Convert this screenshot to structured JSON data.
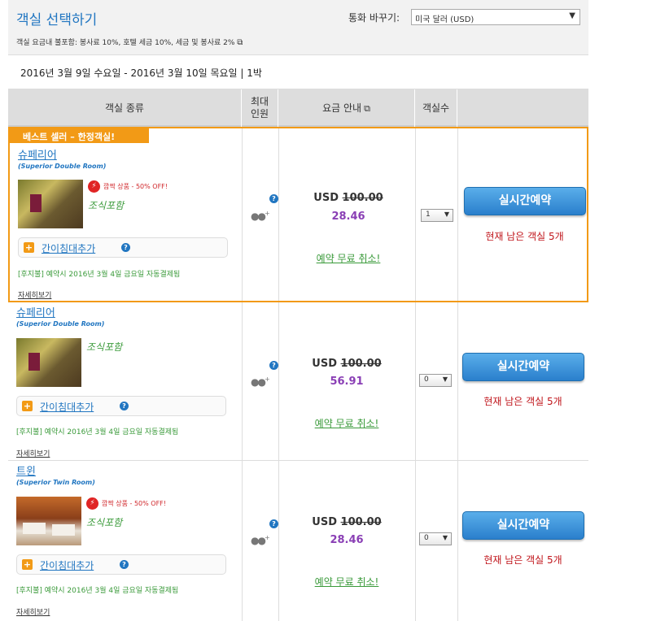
{
  "header": {
    "title": "객실 선택하기",
    "currency_label": "통화 바꾸기:",
    "currency_value": "미국 달러 (USD)",
    "tax_note": "객실 요금내 불포함: 봉사료 10%, 호텔 세금 10%, 세금 및 봉사료 2%"
  },
  "date_range": "2016년 3월 9일 수요일 - 2016년 3월 10일 목요일 | 1박",
  "columns": {
    "room_type": "객실 종류",
    "max_guests_1": "최대",
    "max_guests_2": "인원",
    "rate_info": "요금 안내",
    "rooms": "객실수"
  },
  "best_seller_label": "베스트 셀러 – 한정객실!",
  "rooms": [
    {
      "name": "슈페리어",
      "subtitle": "(Superior Double Room)",
      "deal": "깜짝 상품 - 50% OFF!",
      "breakfast": "조식포함",
      "extra_bed": "간이침대추가",
      "pay_note": "[후지불] 예약시 2016년 3월 4일 금요일 자동결제됨",
      "details": "자세히보기",
      "currency": "USD",
      "original_price": "100.00",
      "final_price": "28.46",
      "free_cancel": "예약 무료 취소!",
      "qty": "1",
      "book_label": "실시간예약",
      "rooms_left": "현재 남은 객실 5개"
    },
    {
      "name": "슈페리어",
      "subtitle": "(Superior Double Room)",
      "breakfast": "조식포함",
      "extra_bed": "간이침대추가",
      "pay_note": "[후지불] 예약시 2016년 3월 4일 금요일 자동결제됨",
      "details": "자세히보기",
      "currency": "USD",
      "original_price": "100.00",
      "final_price": "56.91",
      "free_cancel": "예약 무료 취소!",
      "qty": "0",
      "book_label": "실시간예약",
      "rooms_left": "현재 남은 객실 5개"
    },
    {
      "name": "트윈",
      "subtitle": "(Superior Twin Room)",
      "deal": "깜짝 상품 - 50% OFF!",
      "breakfast": "조식포함",
      "extra_bed": "간이침대추가",
      "pay_note": "[후지불] 예약시 2016년 3월 4일 금요일 자동결제됨",
      "details": "자세히보기",
      "currency": "USD",
      "original_price": "100.00",
      "final_price": "28.46",
      "free_cancel": "예약 무료 취소!",
      "qty": "0",
      "book_label": "실시간예약",
      "rooms_left": "현재 남은 객실 5개"
    }
  ]
}
